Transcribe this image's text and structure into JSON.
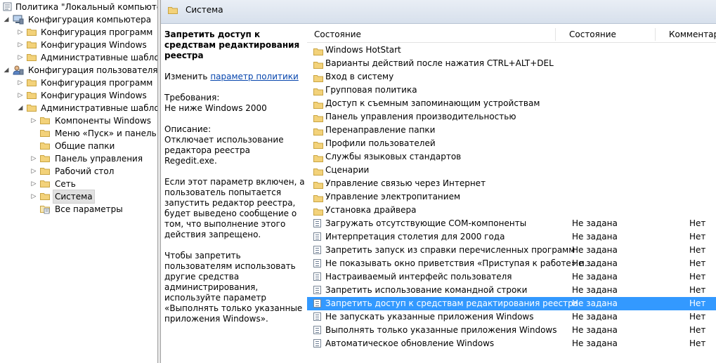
{
  "colors": {
    "selection": "#3399ff",
    "folder": "#f3d27a",
    "link": "#0645ad"
  },
  "tree": {
    "root": "Политика \"Локальный компьютер\"",
    "computer_config": "Конфигурация компьютера",
    "cc_programs": "Конфигурация программ",
    "cc_windows": "Конфигурация Windows",
    "cc_admin": "Административные шаблоны",
    "user_config": "Конфигурация пользователя",
    "uc_programs": "Конфигурация программ",
    "uc_windows": "Конфигурация Windows",
    "uc_admin": "Административные шаблоны",
    "windows_components": "Компоненты Windows",
    "start_menu": "Меню «Пуск» и панель задач",
    "shared_folders": "Общие папки",
    "control_panel": "Панель управления",
    "desktop": "Рабочий стол",
    "network": "Сеть",
    "system": "Система",
    "all_settings": "Все параметры"
  },
  "header": {
    "title": "Система"
  },
  "description": {
    "title": "Запретить доступ к средствам редактирования реестра",
    "edit_prefix": "Изменить",
    "edit_link": "параметр политики",
    "requirements_label": "Требования:",
    "requirements_value": "Не ниже Windows 2000",
    "desc_label": "Описание:",
    "desc_text": "Отключает использование редактора реестра Regedit.exe.",
    "paragraph1": "Если этот параметр включен, а пользователь попытается запустить редактор реестра, будет выведено сообщение о том, что выполнение этого действия запрещено.",
    "paragraph2": "Чтобы запретить пользователям использовать другие средства администрирования, используйте параметр «Выполнять только указанные приложения Windows»."
  },
  "columns": {
    "name": "Состояние",
    "state": "Состояние",
    "comment": "Комментарий"
  },
  "folders": [
    "Windows HotStart",
    "Варианты действий после нажатия CTRL+ALT+DEL",
    "Вход в систему",
    "Групповая политика",
    "Доступ к съемным запоминающим устройствам",
    "Панель управления производительностью",
    "Перенаправление папки",
    "Профили пользователей",
    "Службы языковых стандартов",
    "Сценарии",
    "Управление связью через Интернет",
    "Управление электропитанием",
    "Установка драйвера"
  ],
  "settings": [
    {
      "name": "Загружать отсутствующие COM-компоненты",
      "state": "Не задана",
      "comment": "Нет"
    },
    {
      "name": "Интерпретация столетия для 2000 года",
      "state": "Не задана",
      "comment": "Нет"
    },
    {
      "name": "Запретить запуск из справки перечисленных программ",
      "state": "Не задана",
      "comment": "Нет"
    },
    {
      "name": "Не показывать окно приветствия «Приступая к работе» п...",
      "state": "Не задана",
      "comment": "Нет"
    },
    {
      "name": "Настраиваемый интерфейс пользователя",
      "state": "Не задана",
      "comment": "Нет"
    },
    {
      "name": "Запретить использование командной строки",
      "state": "Не задана",
      "comment": "Нет"
    },
    {
      "name": "Запретить доступ к средствам редактирования реестра",
      "state": "Не задана",
      "comment": "Нет",
      "selected": true
    },
    {
      "name": "Не запускать указанные приложения Windows",
      "state": "Не задана",
      "comment": "Нет"
    },
    {
      "name": "Выполнять только указанные приложения Windows",
      "state": "Не задана",
      "comment": "Нет"
    },
    {
      "name": "Автоматическое обновление Windows",
      "state": "Не задана",
      "comment": "Нет"
    }
  ]
}
